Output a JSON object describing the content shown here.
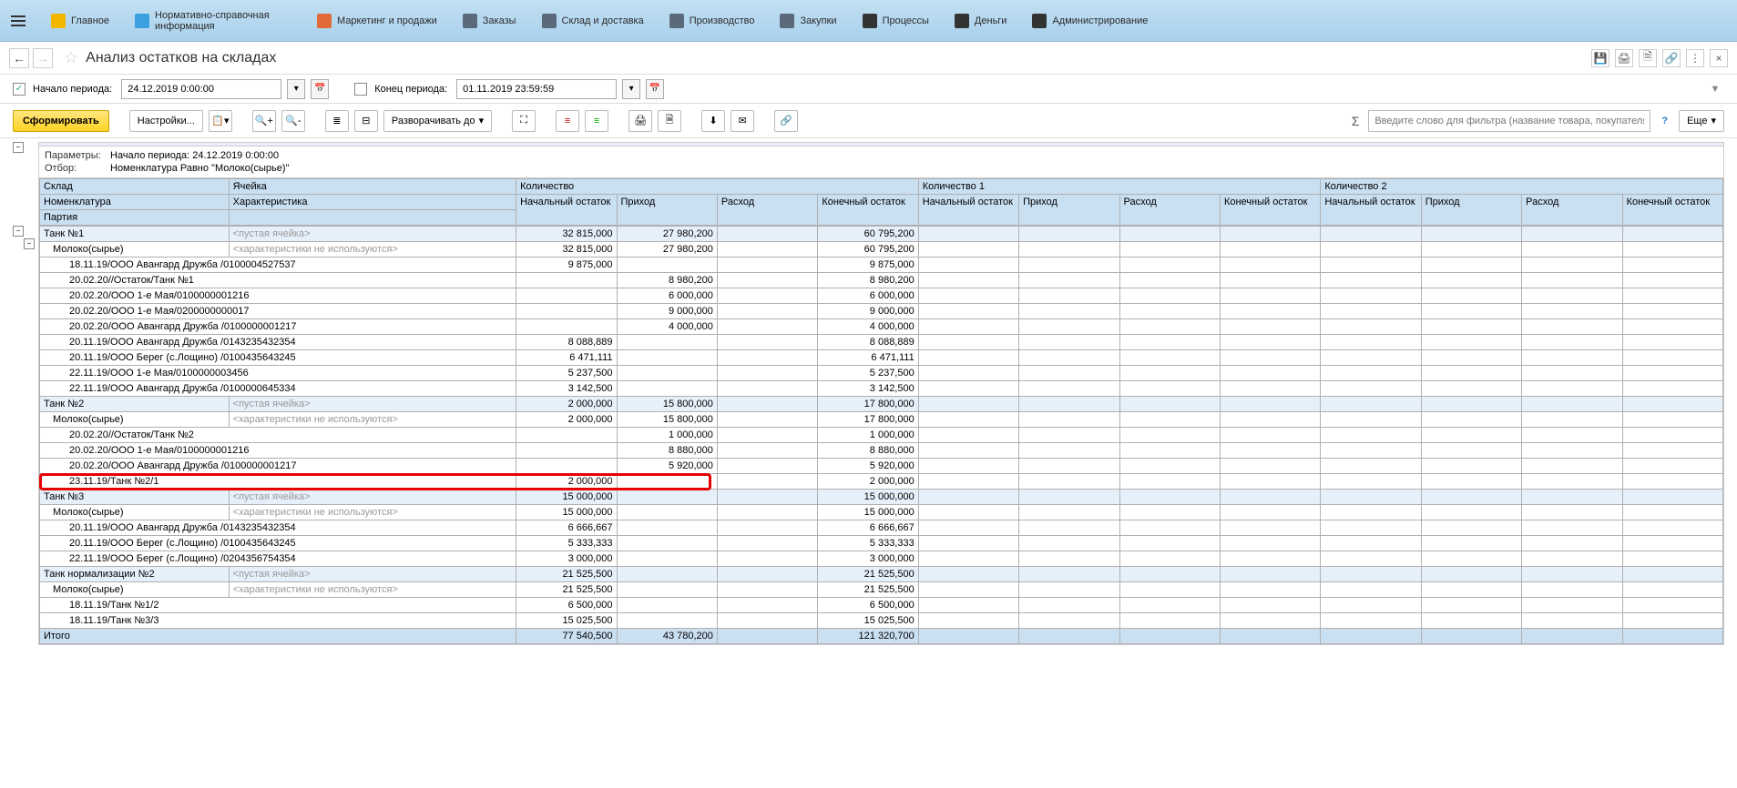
{
  "menu": {
    "items": [
      {
        "label": "Главное",
        "icon_color": "#f2b600"
      },
      {
        "label": "Нормативно-справочная информация",
        "icon_color": "#3aa0e0"
      },
      {
        "label": "Маркетинг и продажи",
        "icon_color": "#e06a3a"
      },
      {
        "label": "Заказы",
        "icon_color": "#5a6a7a"
      },
      {
        "label": "Склад и доставка",
        "icon_color": "#5a6a7a"
      },
      {
        "label": "Производство",
        "icon_color": "#5a6a7a"
      },
      {
        "label": "Закупки",
        "icon_color": "#5a6a7a"
      },
      {
        "label": "Процессы",
        "icon_color": "#333"
      },
      {
        "label": "Деньги",
        "icon_color": "#333"
      },
      {
        "label": "Администрирование",
        "icon_color": "#333"
      }
    ]
  },
  "page": {
    "title": "Анализ остатков на складах"
  },
  "filters": {
    "start_checked": true,
    "start_label": "Начало периода:",
    "start_value": "24.12.2019 0:00:00",
    "end_checked": false,
    "end_label": "Конец периода:",
    "end_value": "01.11.2019 23:59:59"
  },
  "toolbar": {
    "form_label": "Сформировать",
    "settings_label": "Настройки...",
    "expand_label": "Разворачивать до",
    "search_placeholder": "Введите слово для фильтра (название товара, покупателя и пр.)",
    "more_label": "Еще"
  },
  "params": {
    "params_lbl": "Параметры:",
    "params_val": "Начало периода: 24.12.2019 0:00:00",
    "filter_lbl": "Отбор:",
    "filter_val": "Номенклатура Равно \"Молоко(сырье)\""
  },
  "headers": {
    "row1": [
      "Склад",
      "Ячейка",
      "Количество",
      "Количество 1",
      "Количество 2"
    ],
    "row2": [
      "Номенклатура",
      "Характеристика",
      "Начальный остаток",
      "Приход",
      "Расход",
      "Конечный остаток",
      "Начальный остаток",
      "Приход",
      "Расход",
      "Конечный остаток",
      "Начальный остаток",
      "Приход",
      "Расход",
      "Конечный остаток"
    ],
    "row3": [
      "Партия",
      ""
    ]
  },
  "placeholders": {
    "empty_cell": "<пустая ячейка>",
    "no_char": "<характеристики не используются>"
  },
  "rows": [
    {
      "type": "tank",
      "name": "Танк №1",
      "char": "<пустая ячейка>",
      "n": "32 815,000",
      "p": "27 980,200",
      "r": "",
      "k": "60 795,200"
    },
    {
      "type": "nom",
      "name": "Молоко(сырье)",
      "char": "<характеристики не используются>",
      "n": "32 815,000",
      "p": "27 980,200",
      "r": "",
      "k": "60 795,200"
    },
    {
      "type": "party",
      "name": "18.11.19/ООО Авангард Дружба /0100004527537",
      "n": "9 875,000",
      "p": "",
      "r": "",
      "k": "9 875,000"
    },
    {
      "type": "party",
      "name": "20.02.20//Остаток/Танк №1",
      "n": "",
      "p": "8 980,200",
      "r": "",
      "k": "8 980,200"
    },
    {
      "type": "party",
      "name": "20.02.20/ООО 1-е Мая/0100000001216",
      "n": "",
      "p": "6 000,000",
      "r": "",
      "k": "6 000,000"
    },
    {
      "type": "party",
      "name": "20.02.20/ООО 1-е Мая/0200000000017",
      "n": "",
      "p": "9 000,000",
      "r": "",
      "k": "9 000,000"
    },
    {
      "type": "party",
      "name": "20.02.20/ООО Авангард Дружба /0100000001217",
      "n": "",
      "p": "4 000,000",
      "r": "",
      "k": "4 000,000"
    },
    {
      "type": "party",
      "name": "20.11.19/ООО Авангард Дружба /0143235432354",
      "n": "8 088,889",
      "p": "",
      "r": "",
      "k": "8 088,889"
    },
    {
      "type": "party",
      "name": "20.11.19/ООО Берег (с.Лощино) /0100435643245",
      "n": "6 471,111",
      "p": "",
      "r": "",
      "k": "6 471,111"
    },
    {
      "type": "party",
      "name": "22.11.19/ООО 1-е Мая/0100000003456",
      "n": "5 237,500",
      "p": "",
      "r": "",
      "k": "5 237,500"
    },
    {
      "type": "party",
      "name": "22.11.19/ООО Авангард Дружба /0100000645334",
      "n": "3 142,500",
      "p": "",
      "r": "",
      "k": "3 142,500"
    },
    {
      "type": "tank",
      "name": "Танк №2",
      "char": "<пустая ячейка>",
      "n": "2 000,000",
      "p": "15 800,000",
      "r": "",
      "k": "17 800,000"
    },
    {
      "type": "nom",
      "name": "Молоко(сырье)",
      "char": "<характеристики не используются>",
      "n": "2 000,000",
      "p": "15 800,000",
      "r": "",
      "k": "17 800,000"
    },
    {
      "type": "party",
      "name": "20.02.20//Остаток/Танк №2",
      "n": "",
      "p": "1 000,000",
      "r": "",
      "k": "1 000,000"
    },
    {
      "type": "party",
      "name": "20.02.20/ООО 1-е Мая/0100000001216",
      "n": "",
      "p": "8 880,000",
      "r": "",
      "k": "8 880,000"
    },
    {
      "type": "party",
      "name": "20.02.20/ООО Авангард Дружба /0100000001217",
      "n": "",
      "p": "5 920,000",
      "r": "",
      "k": "5 920,000"
    },
    {
      "type": "party",
      "name": "23.11.19/Танк №2/1",
      "n": "2 000,000",
      "p": "",
      "r": "",
      "k": "2 000,000",
      "highlighted": true
    },
    {
      "type": "tank",
      "name": "Танк №3",
      "char": "<пустая ячейка>",
      "n": "15 000,000",
      "p": "",
      "r": "",
      "k": "15 000,000"
    },
    {
      "type": "nom",
      "name": "Молоко(сырье)",
      "char": "<характеристики не используются>",
      "n": "15 000,000",
      "p": "",
      "r": "",
      "k": "15 000,000"
    },
    {
      "type": "party",
      "name": "20.11.19/ООО Авангард Дружба /0143235432354",
      "n": "6 666,667",
      "p": "",
      "r": "",
      "k": "6 666,667"
    },
    {
      "type": "party",
      "name": "20.11.19/ООО Берег (с.Лощино) /0100435643245",
      "n": "5 333,333",
      "p": "",
      "r": "",
      "k": "5 333,333"
    },
    {
      "type": "party",
      "name": "22.11.19/ООО Берег (с.Лощино) /0204356754354",
      "n": "3 000,000",
      "p": "",
      "r": "",
      "k": "3 000,000"
    },
    {
      "type": "tank",
      "name": "Танк нормализации №2",
      "char": "<пустая ячейка>",
      "n": "21 525,500",
      "p": "",
      "r": "",
      "k": "21 525,500"
    },
    {
      "type": "nom",
      "name": "Молоко(сырье)",
      "char": "<характеристики не используются>",
      "n": "21 525,500",
      "p": "",
      "r": "",
      "k": "21 525,500"
    },
    {
      "type": "party",
      "name": "18.11.19/Танк №1/2",
      "n": "6 500,000",
      "p": "",
      "r": "",
      "k": "6 500,000"
    },
    {
      "type": "party",
      "name": "18.11.19/Танк №3/3",
      "n": "15 025,500",
      "p": "",
      "r": "",
      "k": "15 025,500"
    }
  ],
  "total": {
    "label": "Итого",
    "n": "77 540,500",
    "p": "43 780,200",
    "r": "",
    "k": "121 320,700"
  }
}
